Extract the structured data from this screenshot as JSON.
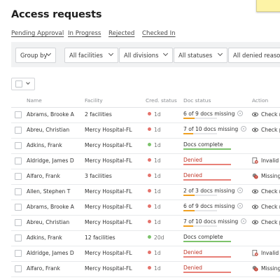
{
  "title": "Access requests",
  "tabs": [
    "Pending Approval",
    "In Progress",
    "Rejected",
    "Checked In"
  ],
  "filters": {
    "group_by": "Group by",
    "facilities": "All facilities",
    "divisions": "All divisions",
    "statuses": "All statuses",
    "denied": "All denied reasons"
  },
  "columns": {
    "name": "Name",
    "facility": "Facility",
    "cred_status": "Cred. status",
    "doc_status": "Doc status",
    "action": "Action"
  },
  "colors": {
    "red_dot": "#e5736c",
    "green_dot": "#7dc36b",
    "orange_bar": "#f0a020",
    "red_bar": "#e88078",
    "green_bar": "#7dc36b",
    "red_text": "#c0392b",
    "filter_bar_bg": "#f1f2f3"
  },
  "rows": [
    {
      "name": "Abrams, Brooke A",
      "facility": "2 facilities",
      "cred": "1d",
      "cred_status": "red",
      "doc": "6 of 9 docs missing",
      "doc_state": "missing",
      "doc_progress": 0.33,
      "info": true,
      "action": "Check ne",
      "action_icon": "eye-icon"
    },
    {
      "name": "Abreu, Christian",
      "facility": "Mercy Hospital-FL",
      "cred": "1d",
      "cred_status": "red",
      "doc": "7 of 10 docs missing",
      "doc_state": "missing",
      "doc_progress": 0.3,
      "info": true,
      "action": "Check pi",
      "action_icon": "eye-icon"
    },
    {
      "name": "Adkins, Frank",
      "facility": "Mercy Hospital-FL",
      "cred": "1d",
      "cred_status": "green",
      "doc": "Docs complete",
      "doc_state": "complete",
      "doc_progress": 1,
      "info": false,
      "action": "",
      "action_icon": ""
    },
    {
      "name": "Aldridge, James D",
      "facility": "Mercy Hospital-FL",
      "cred": "1d",
      "cred_status": "red",
      "doc": "Denied",
      "doc_state": "denied",
      "doc_progress": 1,
      "info": false,
      "action": "Invalid p",
      "action_icon": "invalid-doc-icon"
    },
    {
      "name": "Alfaro, Frank",
      "facility": "3 facilities",
      "cred": "1d",
      "cred_status": "red",
      "doc": "Denied",
      "doc_state": "denied",
      "doc_progress": 1,
      "info": false,
      "action": "Missing f",
      "action_icon": "missing-icon"
    },
    {
      "name": "Allen, Stephen T",
      "facility": "Mercy Hospital-FL",
      "cred": "1d",
      "cred_status": "red",
      "doc": "2 of 3 docs missing",
      "doc_state": "missing",
      "doc_progress": 0.33,
      "info": true,
      "action": "Check ne",
      "action_icon": "eye-icon"
    },
    {
      "name": "Abrams, Brooke A",
      "facility": "Mercy Hospital-FL",
      "cred": "1d",
      "cred_status": "red",
      "doc": "6 of 9 docs missing",
      "doc_state": "missing",
      "doc_progress": 0.33,
      "info": true,
      "action": "Check ne",
      "action_icon": "eye-icon"
    },
    {
      "name": "Abreu, Christian",
      "facility": "Mercy Hospital-FL",
      "cred": "1d",
      "cred_status": "red",
      "doc": "7 of 10 docs missing",
      "doc_state": "missing",
      "doc_progress": 0.3,
      "info": true,
      "action": "Check pi",
      "action_icon": "eye-icon"
    },
    {
      "name": "Adkins, Frank",
      "facility": "12 facilities",
      "cred": "20d",
      "cred_status": "green",
      "doc": "Docs complete",
      "doc_state": "complete",
      "doc_progress": 1,
      "info": false,
      "action": "",
      "action_icon": ""
    },
    {
      "name": "Aldridge, James D",
      "facility": "Mercy Hospital-FL",
      "cred": "1d",
      "cred_status": "red",
      "doc": "Denied",
      "doc_state": "denied",
      "doc_progress": 1,
      "info": false,
      "action": "Invalid p",
      "action_icon": "invalid-doc-icon"
    },
    {
      "name": "Alfaro, Frank",
      "facility": "Mercy Hospital-FL",
      "cred": "1d",
      "cred_status": "red",
      "doc": "Denied",
      "doc_state": "denied",
      "doc_progress": 1,
      "info": false,
      "action": "Missing f",
      "action_icon": "missing-icon"
    }
  ]
}
